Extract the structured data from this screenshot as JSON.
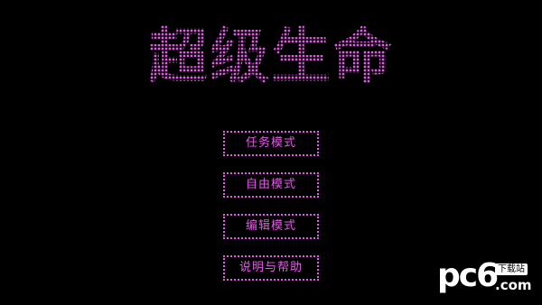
{
  "title": "超级生命",
  "menu": {
    "items": [
      {
        "label": "任务模式"
      },
      {
        "label": "自由模式"
      },
      {
        "label": "编辑模式"
      },
      {
        "label": "说明与帮助"
      }
    ]
  },
  "watermark": {
    "logo_text": "pc6",
    "badge": "下载站",
    "domain": ".com"
  },
  "colors": {
    "background": "#000000",
    "accent": "#e35be6",
    "watermark": "#ffffff"
  }
}
